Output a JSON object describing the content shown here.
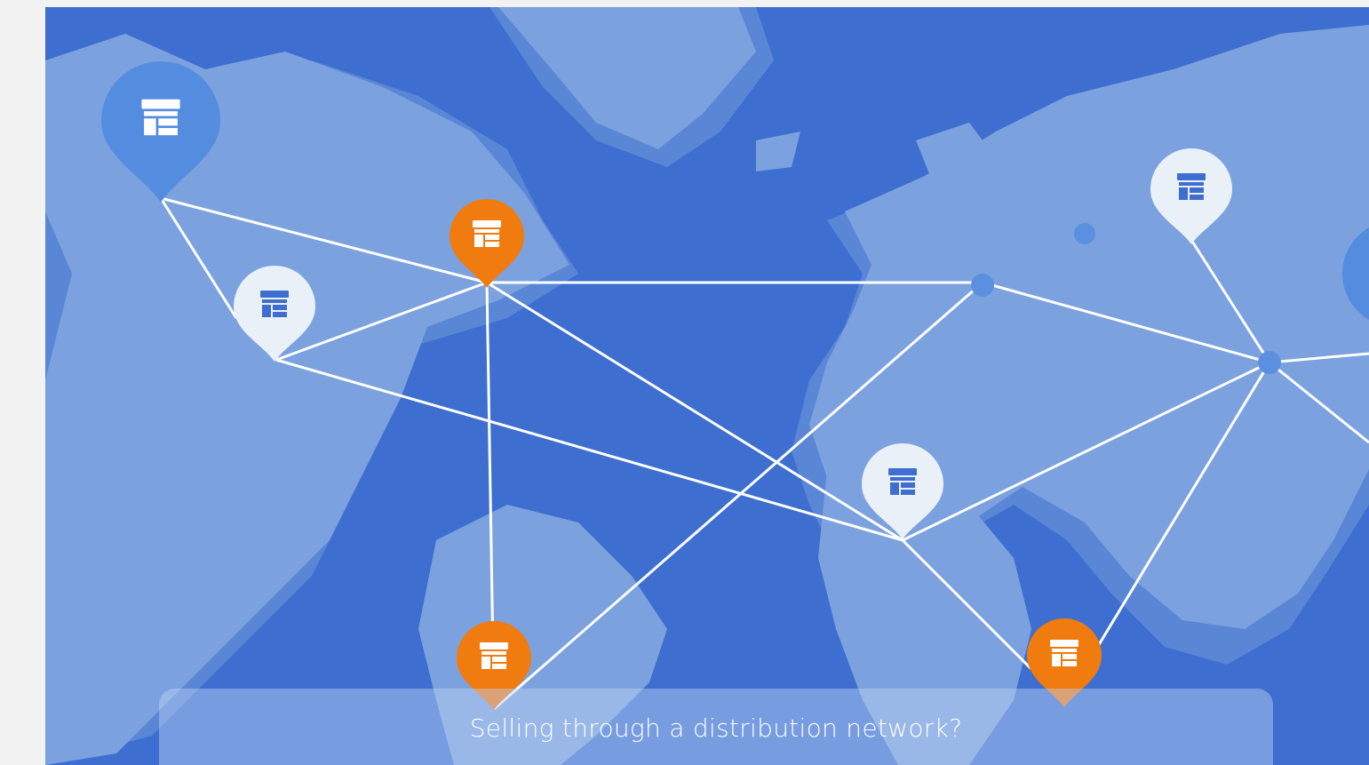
{
  "hero": {
    "caption": "Selling through a distribution network?"
  },
  "icons": {
    "store": "storefront-icon",
    "pin": "map-pin-icon"
  },
  "colors": {
    "ocean": "#3e6fd0",
    "land": "#7ba2de",
    "land_shadow": "#5a86d6",
    "route_line": "#ffffff",
    "pin_orange": "#f07b0f",
    "pin_light": "#eaf0f8",
    "pin_blue": "#548de0",
    "hub_dot": "#5b8fe0"
  }
}
